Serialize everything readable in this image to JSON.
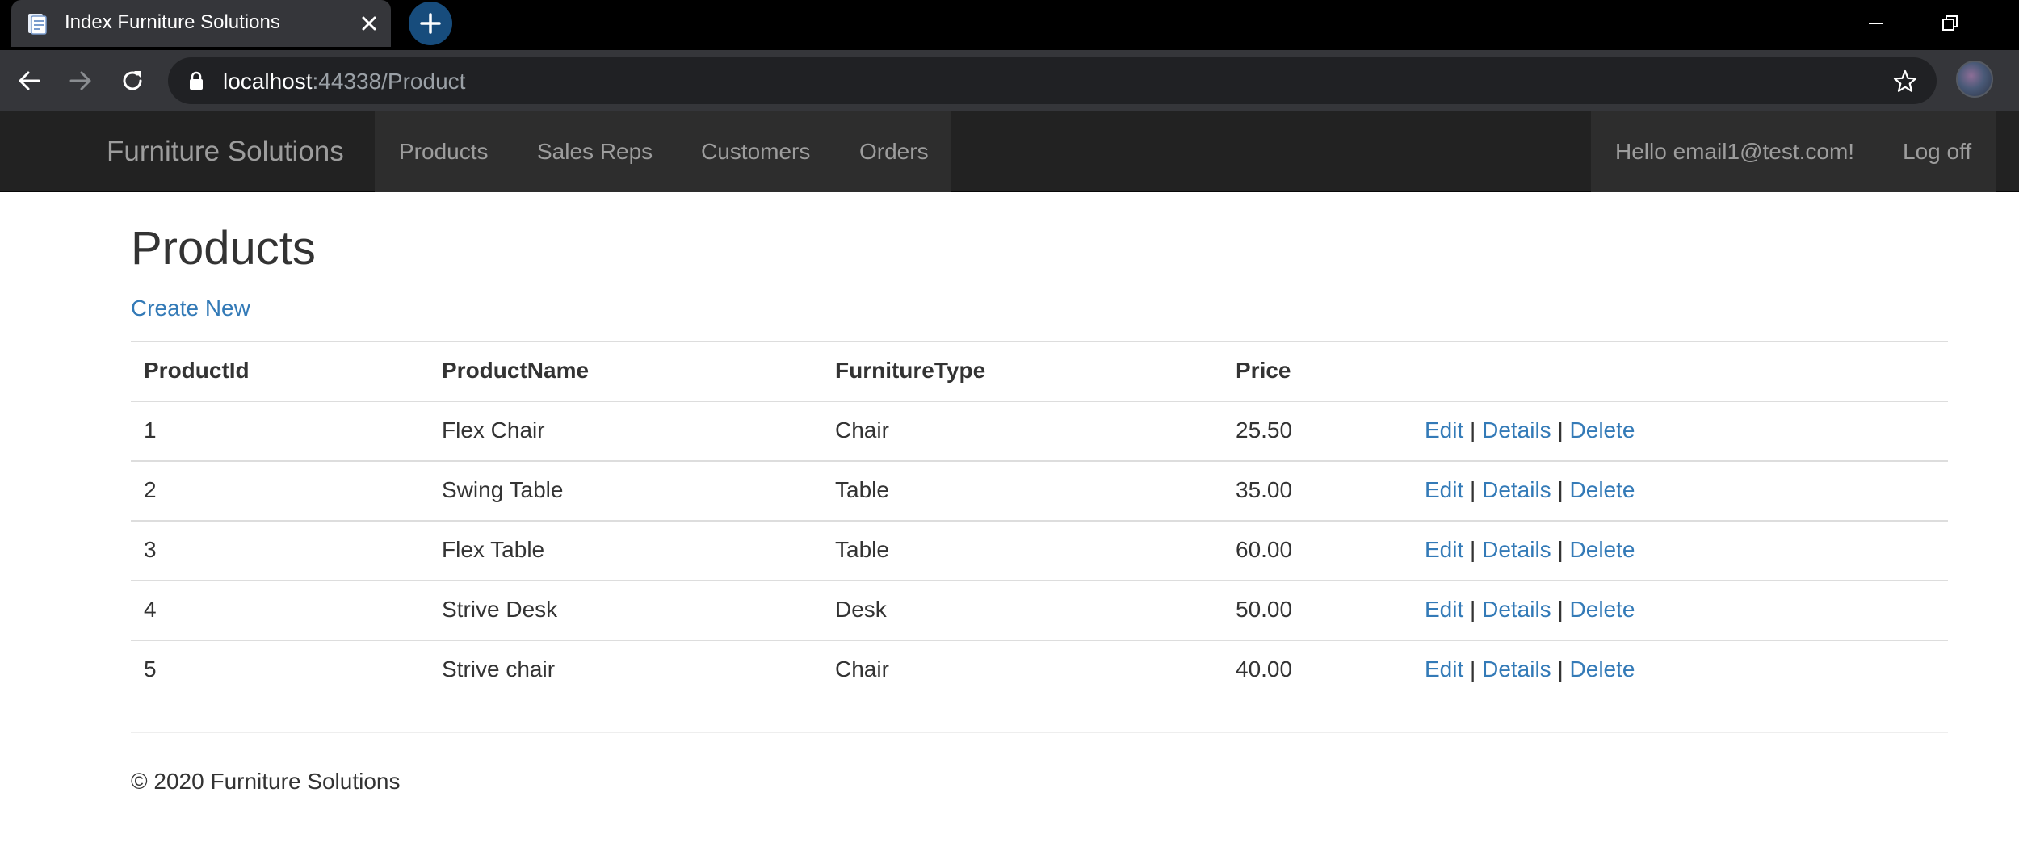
{
  "browser": {
    "tab_title": "Index Furniture Solutions",
    "url_host": "localhost",
    "url_rest": ":44338/Product",
    "icons": {
      "favicon": "page-icon",
      "tab_close": "close-icon",
      "new_tab": "plus-icon",
      "back": "back-arrow-icon",
      "forward": "forward-arrow-icon",
      "reload": "reload-icon",
      "lock": "lock-icon",
      "bookmark": "star-icon",
      "minimize": "minimize-icon",
      "restore": "restore-icon"
    }
  },
  "navbar": {
    "brand": "Furniture Solutions",
    "items": [
      {
        "label": "Products"
      },
      {
        "label": "Sales Reps"
      },
      {
        "label": "Customers"
      },
      {
        "label": "Orders"
      }
    ],
    "greeting": "Hello email1@test.com!",
    "logoff": "Log off"
  },
  "page": {
    "title": "Products",
    "create_new": "Create New"
  },
  "table": {
    "headers": [
      "ProductId",
      "ProductName",
      "FurnitureType",
      "Price"
    ],
    "rows": [
      {
        "id": "1",
        "name": "Flex Chair",
        "type": "Chair",
        "price": "25.50"
      },
      {
        "id": "2",
        "name": "Swing Table",
        "type": "Table",
        "price": "35.00"
      },
      {
        "id": "3",
        "name": "Flex Table",
        "type": "Table",
        "price": "60.00"
      },
      {
        "id": "4",
        "name": "Strive Desk",
        "type": "Desk",
        "price": "50.00"
      },
      {
        "id": "5",
        "name": "Strive chair",
        "type": "Chair",
        "price": "40.00"
      }
    ],
    "actions": {
      "edit": "Edit",
      "details": "Details",
      "delete": "Delete",
      "separator": "|"
    }
  },
  "footer": {
    "text": "© 2020 Furniture Solutions"
  },
  "colors": {
    "link": "#337ab7",
    "navbar_bg": "#222222",
    "navbar_text": "#9d9d9d",
    "browser_frame": "#000000",
    "browser_toolbar": "#35363a"
  }
}
